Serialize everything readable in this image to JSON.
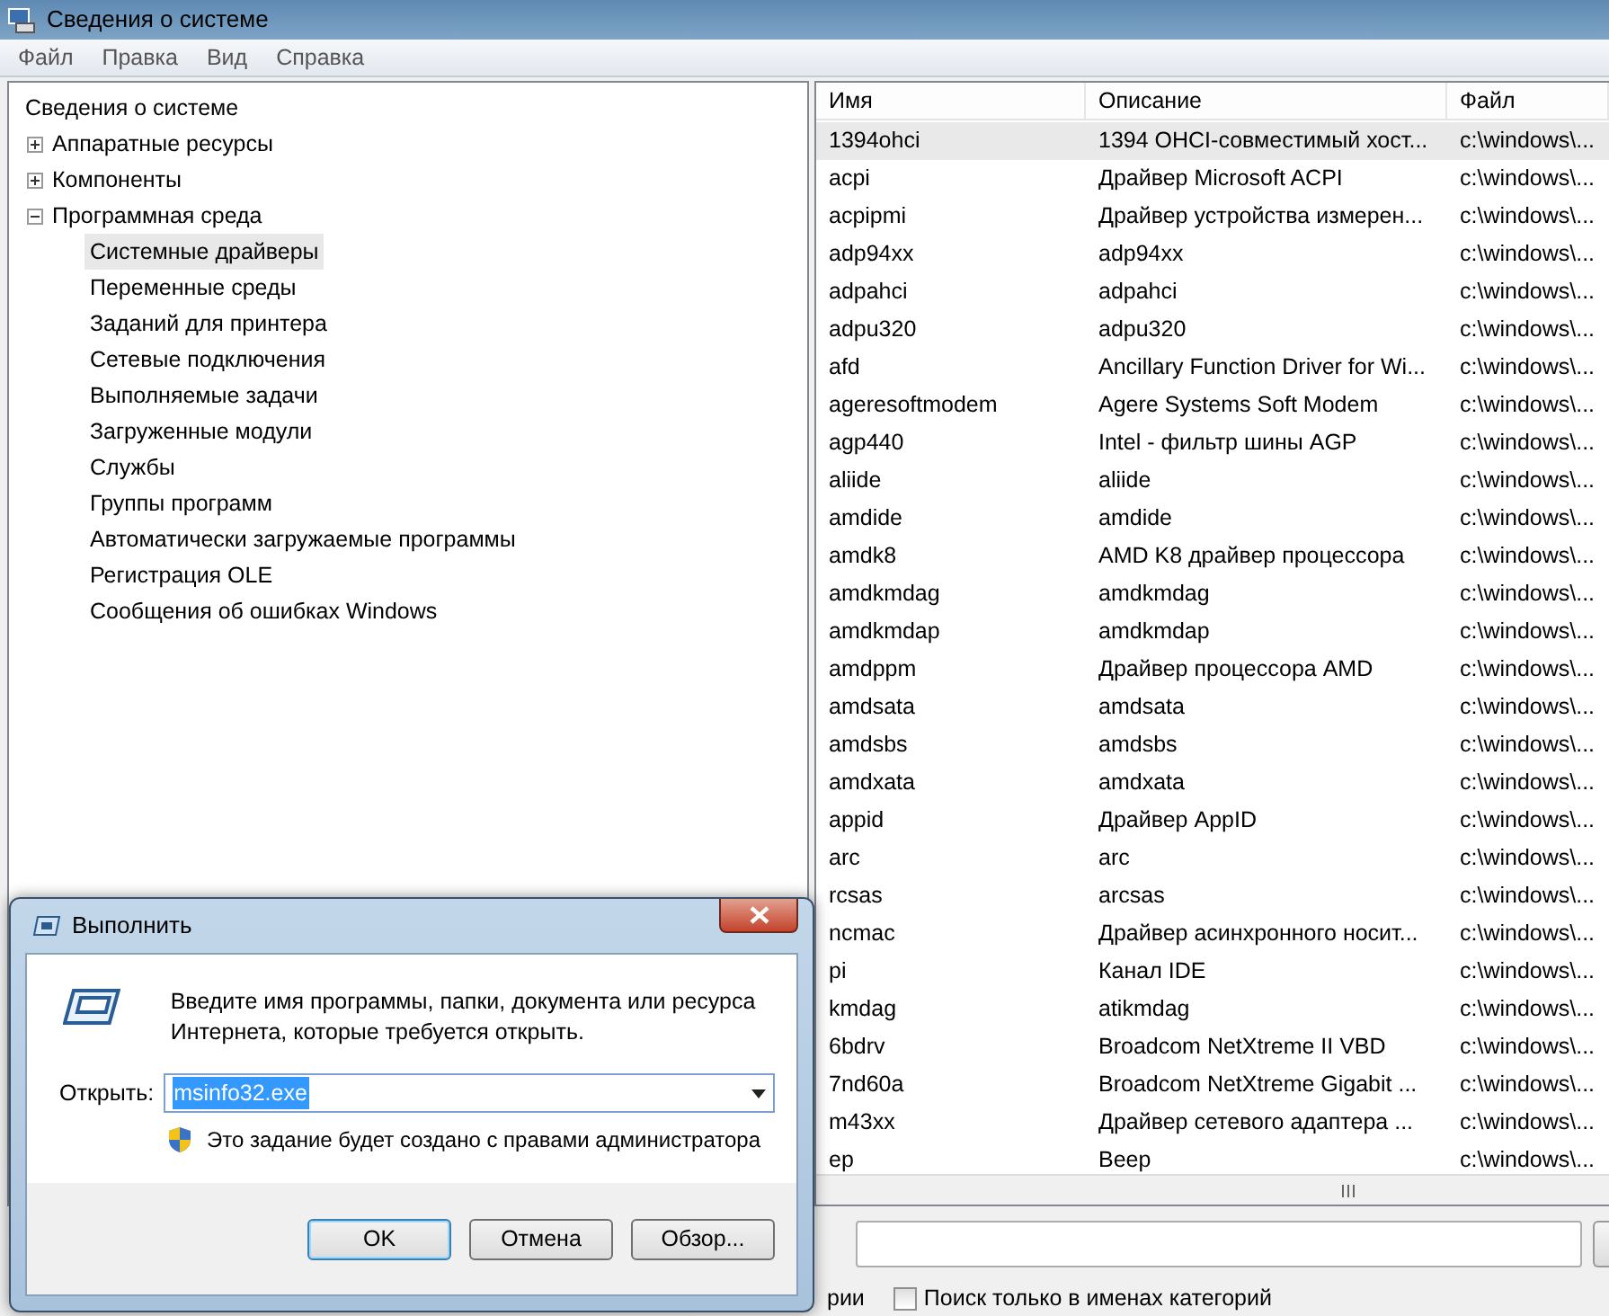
{
  "window": {
    "title": "Сведения о системе"
  },
  "menu": [
    "Файл",
    "Правка",
    "Вид",
    "Справка"
  ],
  "tree": {
    "label": "Сведения о системе",
    "selected": false,
    "children": [
      {
        "label": "Аппаратные ресурсы",
        "expanded": false,
        "selected": false
      },
      {
        "label": "Компоненты",
        "expanded": false,
        "selected": false
      },
      {
        "label": "Программная среда",
        "expanded": true,
        "selected": false,
        "children": [
          {
            "label": "Системные драйверы",
            "selected": true
          },
          {
            "label": "Переменные среды",
            "selected": false
          },
          {
            "label": "Заданий для принтера",
            "selected": false
          },
          {
            "label": "Сетевые подключения",
            "selected": false
          },
          {
            "label": "Выполняемые задачи",
            "selected": false
          },
          {
            "label": "Загруженные модули",
            "selected": false
          },
          {
            "label": "Службы",
            "selected": false
          },
          {
            "label": "Группы программ",
            "selected": false
          },
          {
            "label": "Автоматически загружаемые программы",
            "selected": false
          },
          {
            "label": "Регистрация OLE",
            "selected": false
          },
          {
            "label": "Сообщения об ошибках Windows",
            "selected": false
          }
        ]
      }
    ]
  },
  "table": {
    "columns": [
      "Имя",
      "Описание",
      "Файл"
    ],
    "rows": [
      {
        "cells": [
          "1394ohci",
          "1394 OHCI-совместимый хост...",
          "c:\\windows\\..."
        ],
        "selected": true
      },
      {
        "cells": [
          "acpi",
          "Драйвер Microsoft ACPI",
          "c:\\windows\\..."
        ],
        "selected": false
      },
      {
        "cells": [
          "acpipmi",
          "Драйвер устройства измерен...",
          "c:\\windows\\..."
        ],
        "selected": false
      },
      {
        "cells": [
          "adp94xx",
          "adp94xx",
          "c:\\windows\\..."
        ],
        "selected": false
      },
      {
        "cells": [
          "adpahci",
          "adpahci",
          "c:\\windows\\..."
        ],
        "selected": false
      },
      {
        "cells": [
          "adpu320",
          "adpu320",
          "c:\\windows\\..."
        ],
        "selected": false
      },
      {
        "cells": [
          "afd",
          "Ancillary Function Driver for Wi...",
          "c:\\windows\\..."
        ],
        "selected": false
      },
      {
        "cells": [
          "ageresoftmodem",
          "Agere Systems Soft Modem",
          "c:\\windows\\..."
        ],
        "selected": false
      },
      {
        "cells": [
          "agp440",
          "Intel - фильтр шины AGP",
          "c:\\windows\\..."
        ],
        "selected": false
      },
      {
        "cells": [
          "aliide",
          "aliide",
          "c:\\windows\\..."
        ],
        "selected": false
      },
      {
        "cells": [
          "amdide",
          "amdide",
          "c:\\windows\\..."
        ],
        "selected": false
      },
      {
        "cells": [
          "amdk8",
          "AMD K8 драйвер процессора",
          "c:\\windows\\..."
        ],
        "selected": false
      },
      {
        "cells": [
          "amdkmdag",
          "amdkmdag",
          "c:\\windows\\..."
        ],
        "selected": false
      },
      {
        "cells": [
          "amdkmdap",
          "amdkmdap",
          "c:\\windows\\..."
        ],
        "selected": false
      },
      {
        "cells": [
          "amdppm",
          "Драйвер процессора AMD",
          "c:\\windows\\..."
        ],
        "selected": false
      },
      {
        "cells": [
          "amdsata",
          "amdsata",
          "c:\\windows\\..."
        ],
        "selected": false
      },
      {
        "cells": [
          "amdsbs",
          "amdsbs",
          "c:\\windows\\..."
        ],
        "selected": false
      },
      {
        "cells": [
          "amdxata",
          "amdxata",
          "c:\\windows\\..."
        ],
        "selected": false
      },
      {
        "cells": [
          "appid",
          "Драйвер AppID",
          "c:\\windows\\..."
        ],
        "selected": false
      },
      {
        "cells": [
          "arc",
          "arc",
          "c:\\windows\\..."
        ],
        "selected": false
      },
      {
        "cells": [
          "rcsas",
          "arcsas",
          "c:\\windows\\..."
        ],
        "selected": false
      },
      {
        "cells": [
          "ncmac",
          "Драйвер асинхронного носит...",
          "c:\\windows\\..."
        ],
        "selected": false
      },
      {
        "cells": [
          "pi",
          "Канал IDE",
          "c:\\windows\\..."
        ],
        "selected": false
      },
      {
        "cells": [
          "kmdag",
          "atikmdag",
          "c:\\windows\\..."
        ],
        "selected": false
      },
      {
        "cells": [
          "6bdrv",
          "Broadcom NetXtreme II VBD",
          "c:\\windows\\..."
        ],
        "selected": false
      },
      {
        "cells": [
          "7nd60a",
          "Broadcom NetXtreme Gigabit ...",
          "c:\\windows\\..."
        ],
        "selected": false
      },
      {
        "cells": [
          "m43xx",
          "Драйвер сетевого адаптера ...",
          "c:\\windows\\..."
        ],
        "selected": false
      },
      {
        "cells": [
          "ep",
          "Beep",
          "c:\\windows\\..."
        ],
        "selected": false
      }
    ]
  },
  "search_area": {
    "option_tail": "рии",
    "options": [
      {
        "label": "Поиск только в именах категорий",
        "checked": false
      }
    ]
  },
  "run_dialog": {
    "title": "Выполнить",
    "prompt": "Введите имя программы, папки, документа или ресурса Интернета, которые требуется открыть.",
    "open_label": "Открыть:",
    "value": "msinfo32.exe",
    "value_selected": true,
    "admin_note": "Это задание будет создано с правами администратора",
    "buttons": [
      {
        "label": "OK",
        "default": true
      },
      {
        "label": "Отмена",
        "default": false
      },
      {
        "label": "Обзор...",
        "default": false
      }
    ]
  }
}
